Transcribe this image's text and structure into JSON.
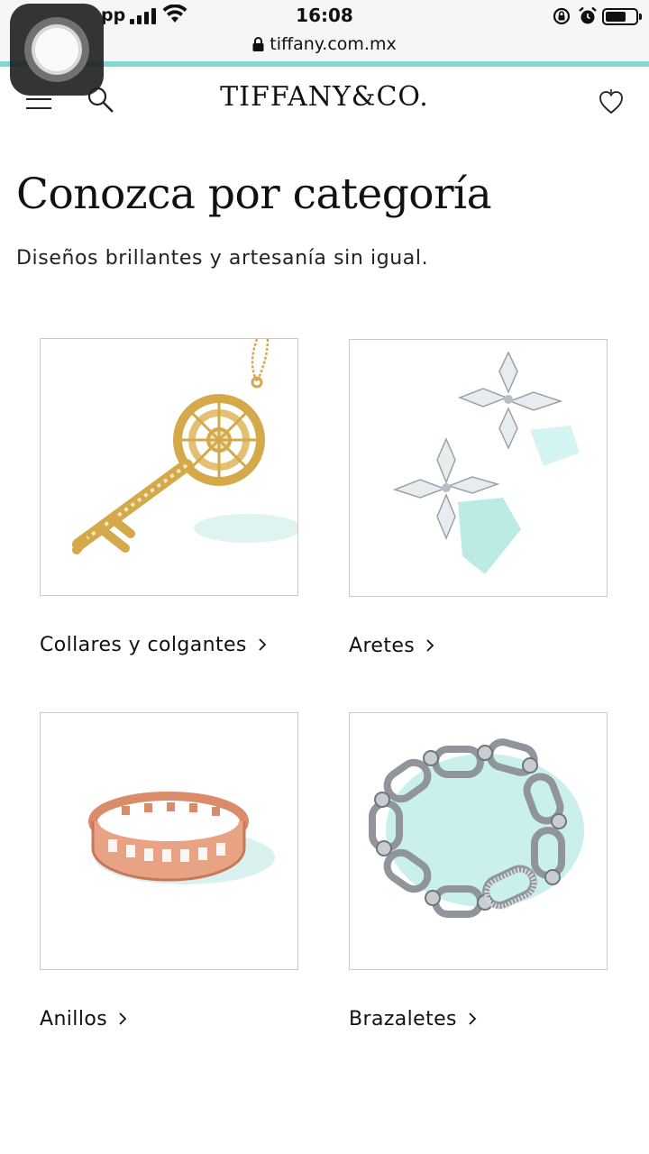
{
  "status_bar": {
    "carrier": "pp",
    "time": "16:08",
    "battery_level": 0.62
  },
  "browser": {
    "url": "tiffany.com.mx"
  },
  "header": {
    "logo": "TIFFANY&CO."
  },
  "main": {
    "title": "Conozca por categoría",
    "subtitle": "Diseños brillantes y artesanía sin igual.",
    "categories": [
      {
        "label": "Collares y colgantes",
        "icon": "key-pendant-image"
      },
      {
        "label": "Aretes",
        "icon": "diamond-earrings-image"
      },
      {
        "label": "Anillos",
        "icon": "rose-gold-ring-image"
      },
      {
        "label": "Brazaletes",
        "icon": "silver-link-bracelet-image"
      }
    ]
  },
  "colors": {
    "brand_teal": "#81d8d0",
    "gold": "#d4a94a",
    "rose_gold": "#d98b6a",
    "silver": "#b9bcc0"
  }
}
